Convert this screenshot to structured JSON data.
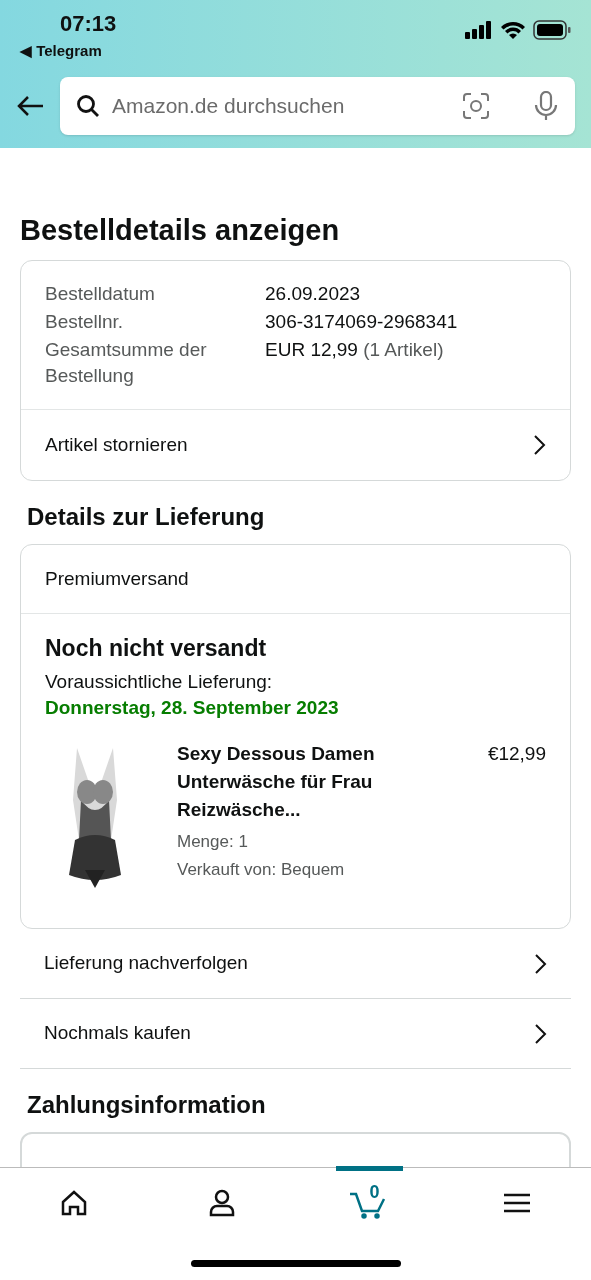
{
  "status_bar": {
    "time": "07:13",
    "back_app": "◀ Telegram"
  },
  "search": {
    "placeholder": "Amazon.de durchsuchen"
  },
  "page_title": "Bestelldetails anzeigen",
  "order_summary": {
    "fields": [
      {
        "label": "Bestelldatum",
        "value": "26.09.2023"
      },
      {
        "label": "Bestellnr.",
        "value": "306-3174069-2968341"
      },
      {
        "label": "Gesamtsumme der Bestellung",
        "value": "EUR 12,99",
        "note": "(1 Artikel)"
      }
    ],
    "action": "Artikel stornieren"
  },
  "delivery": {
    "heading": "Details zur Lieferung",
    "shipping_method": "Premiumversand",
    "status": "Noch nicht versandt",
    "eta_label": "Voraussichtliche Lieferung:",
    "eta_date": "Donnerstag, 28. September 2023",
    "item": {
      "kind": "picture",
      "title": "Sexy Dessous Damen Unterwäsche für Frau Reizwäsche...",
      "price": "€12,99",
      "quantity": "Menge: 1",
      "seller": "Verkauft von: Bequem"
    }
  },
  "actions": [
    "Lieferung nachverfolgen",
    "Nochmals kaufen"
  ],
  "payment": {
    "heading": "Zahlungsinformation"
  },
  "tab_bar": [
    {
      "kind": "home",
      "selected": false
    },
    {
      "kind": "account",
      "selected": false
    },
    {
      "kind": "cart",
      "selected": true,
      "count": "0"
    },
    {
      "kind": "menu",
      "selected": false
    }
  ]
}
